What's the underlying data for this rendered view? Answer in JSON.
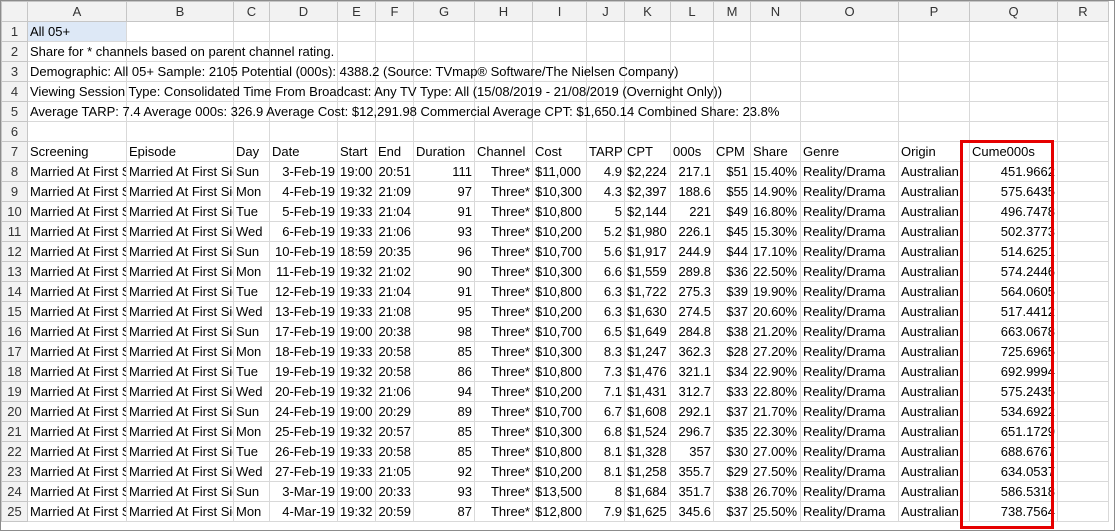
{
  "columns": [
    "A",
    "B",
    "C",
    "D",
    "E",
    "F",
    "G",
    "H",
    "I",
    "J",
    "K",
    "L",
    "M",
    "N",
    "O",
    "P",
    "Q",
    "R"
  ],
  "info_rows": [
    {
      "row": "1",
      "text": "All 05+"
    },
    {
      "row": "2",
      "text": "Share for * channels based on parent channel rating."
    },
    {
      "row": "3",
      "text": "Demographic: All 05+   Sample: 2105   Potential (000s): 4388.2   (Source: TVmap® Software/The Nielsen Company)"
    },
    {
      "row": "4",
      "text": "Viewing Session Type: Consolidated   Time From Broadcast: Any   TV Type: All   (15/08/2019 - 21/08/2019 (Overnight Only))"
    },
    {
      "row": "5",
      "text": "Average TARP: 7.4   Average 000s: 326.9   Average Cost: $12,291.98   Commercial Average CPT: $1,650.14   Combined Share: 23.8%"
    },
    {
      "row": "6",
      "text": ""
    }
  ],
  "header_row": {
    "row": "7",
    "cells": [
      "Screening",
      "Episode",
      "Day",
      "Date",
      "Start",
      "End",
      "Duration",
      "Channel",
      "Cost",
      "TARP",
      "CPT",
      "000s",
      "CPM",
      "Share",
      "Genre",
      "Origin",
      "Cume000s",
      ""
    ]
  },
  "data_rows": [
    {
      "row": "8",
      "cells": [
        "Married At First Sight",
        "Married At First Sight",
        "Sun",
        "3-Feb-19",
        "19:00",
        "20:51",
        "111",
        "Three*",
        "$11,000",
        "4.9",
        "$2,224",
        "217.1",
        "$51",
        "15.40%",
        "Reality/Drama",
        "Australian",
        "451.9662",
        ""
      ]
    },
    {
      "row": "9",
      "cells": [
        "Married At First Sight",
        "Married At First Sight",
        "Mon",
        "4-Feb-19",
        "19:32",
        "21:09",
        "97",
        "Three*",
        "$10,300",
        "4.3",
        "$2,397",
        "188.6",
        "$55",
        "14.90%",
        "Reality/Drama",
        "Australian",
        "575.6435",
        ""
      ]
    },
    {
      "row": "10",
      "cells": [
        "Married At First Sight",
        "Married At First Sight",
        "Tue",
        "5-Feb-19",
        "19:33",
        "21:04",
        "91",
        "Three*",
        "$10,800",
        "5",
        "$2,144",
        "221",
        "$49",
        "16.80%",
        "Reality/Drama",
        "Australian",
        "496.7478",
        ""
      ]
    },
    {
      "row": "11",
      "cells": [
        "Married At First Sight",
        "Married At First Sight",
        "Wed",
        "6-Feb-19",
        "19:33",
        "21:06",
        "93",
        "Three*",
        "$10,200",
        "5.2",
        "$1,980",
        "226.1",
        "$45",
        "15.30%",
        "Reality/Drama",
        "Australian",
        "502.3773",
        ""
      ]
    },
    {
      "row": "12",
      "cells": [
        "Married At First Sight",
        "Married At First Sight",
        "Sun",
        "10-Feb-19",
        "18:59",
        "20:35",
        "96",
        "Three*",
        "$10,700",
        "5.6",
        "$1,917",
        "244.9",
        "$44",
        "17.10%",
        "Reality/Drama",
        "Australian",
        "514.6251",
        ""
      ]
    },
    {
      "row": "13",
      "cells": [
        "Married At First Sight",
        "Married At First Sight",
        "Mon",
        "11-Feb-19",
        "19:32",
        "21:02",
        "90",
        "Three*",
        "$10,300",
        "6.6",
        "$1,559",
        "289.8",
        "$36",
        "22.50%",
        "Reality/Drama",
        "Australian",
        "574.2446",
        ""
      ]
    },
    {
      "row": "14",
      "cells": [
        "Married At First Sight",
        "Married At First Sight",
        "Tue",
        "12-Feb-19",
        "19:33",
        "21:04",
        "91",
        "Three*",
        "$10,800",
        "6.3",
        "$1,722",
        "275.3",
        "$39",
        "19.90%",
        "Reality/Drama",
        "Australian",
        "564.0605",
        ""
      ]
    },
    {
      "row": "15",
      "cells": [
        "Married At First Sight",
        "Married At First Sight",
        "Wed",
        "13-Feb-19",
        "19:33",
        "21:08",
        "95",
        "Three*",
        "$10,200",
        "6.3",
        "$1,630",
        "274.5",
        "$37",
        "20.60%",
        "Reality/Drama",
        "Australian",
        "517.4412",
        ""
      ]
    },
    {
      "row": "16",
      "cells": [
        "Married At First Sight",
        "Married At First Sight",
        "Sun",
        "17-Feb-19",
        "19:00",
        "20:38",
        "98",
        "Three*",
        "$10,700",
        "6.5",
        "$1,649",
        "284.8",
        "$38",
        "21.20%",
        "Reality/Drama",
        "Australian",
        "663.0678",
        ""
      ]
    },
    {
      "row": "17",
      "cells": [
        "Married At First Sight",
        "Married At First Sight",
        "Mon",
        "18-Feb-19",
        "19:33",
        "20:58",
        "85",
        "Three*",
        "$10,300",
        "8.3",
        "$1,247",
        "362.3",
        "$28",
        "27.20%",
        "Reality/Drama",
        "Australian",
        "725.6965",
        ""
      ]
    },
    {
      "row": "18",
      "cells": [
        "Married At First Sight",
        "Married At First Sight",
        "Tue",
        "19-Feb-19",
        "19:32",
        "20:58",
        "86",
        "Three*",
        "$10,800",
        "7.3",
        "$1,476",
        "321.1",
        "$34",
        "22.90%",
        "Reality/Drama",
        "Australian",
        "692.9994",
        ""
      ]
    },
    {
      "row": "19",
      "cells": [
        "Married At First Sight",
        "Married At First Sight",
        "Wed",
        "20-Feb-19",
        "19:32",
        "21:06",
        "94",
        "Three*",
        "$10,200",
        "7.1",
        "$1,431",
        "312.7",
        "$33",
        "22.80%",
        "Reality/Drama",
        "Australian",
        "575.2435",
        ""
      ]
    },
    {
      "row": "20",
      "cells": [
        "Married At First Sight",
        "Married At First Sight",
        "Sun",
        "24-Feb-19",
        "19:00",
        "20:29",
        "89",
        "Three*",
        "$10,700",
        "6.7",
        "$1,608",
        "292.1",
        "$37",
        "21.70%",
        "Reality/Drama",
        "Australian",
        "534.6922",
        ""
      ]
    },
    {
      "row": "21",
      "cells": [
        "Married At First Sight",
        "Married At First Sight",
        "Mon",
        "25-Feb-19",
        "19:32",
        "20:57",
        "85",
        "Three*",
        "$10,300",
        "6.8",
        "$1,524",
        "296.7",
        "$35",
        "22.30%",
        "Reality/Drama",
        "Australian",
        "651.1729",
        ""
      ]
    },
    {
      "row": "22",
      "cells": [
        "Married At First Sight",
        "Married At First Sight",
        "Tue",
        "26-Feb-19",
        "19:33",
        "20:58",
        "85",
        "Three*",
        "$10,800",
        "8.1",
        "$1,328",
        "357",
        "$30",
        "27.00%",
        "Reality/Drama",
        "Australian",
        "688.6767",
        ""
      ]
    },
    {
      "row": "23",
      "cells": [
        "Married At First Sight",
        "Married At First Sight",
        "Wed",
        "27-Feb-19",
        "19:33",
        "21:05",
        "92",
        "Three*",
        "$10,200",
        "8.1",
        "$1,258",
        "355.7",
        "$29",
        "27.50%",
        "Reality/Drama",
        "Australian",
        "634.0537",
        ""
      ]
    },
    {
      "row": "24",
      "cells": [
        "Married At First Sight",
        "Married At First Sight",
        "Sun",
        "3-Mar-19",
        "19:00",
        "20:33",
        "93",
        "Three*",
        "$13,500",
        "8",
        "$1,684",
        "351.7",
        "$38",
        "26.70%",
        "Reality/Drama",
        "Australian",
        "586.5318",
        ""
      ]
    },
    {
      "row": "25",
      "cells": [
        "Married At First Sight",
        "Married At First Sight",
        "Mon",
        "4-Mar-19",
        "19:32",
        "20:59",
        "87",
        "Three*",
        "$12,800",
        "7.9",
        "$1,625",
        "345.6",
        "$37",
        "25.50%",
        "Reality/Drama",
        "Australian",
        "738.7564",
        ""
      ]
    }
  ],
  "align": [
    "l",
    "l",
    "l",
    "r",
    "l",
    "r",
    "r",
    "r",
    "l",
    "r",
    "l",
    "r",
    "r",
    "l",
    "l",
    "l",
    "r",
    "l"
  ],
  "colors": {
    "highlight_border": "#e60000",
    "selected_cell": "#dde8f6",
    "header_bg": "#f2f2f2"
  }
}
